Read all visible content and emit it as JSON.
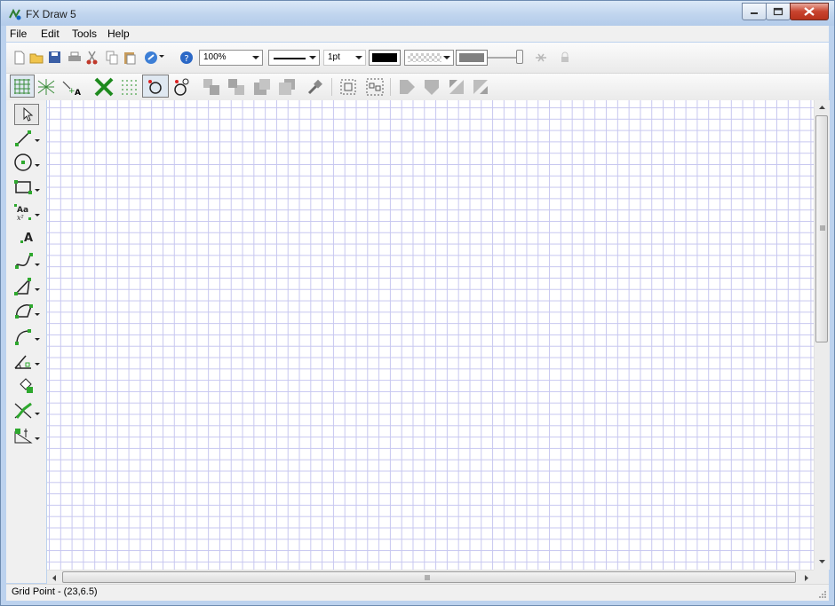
{
  "window": {
    "title": "FX Draw 5"
  },
  "menu": {
    "file": "File",
    "edit": "Edit",
    "tools": "Tools",
    "help": "Help"
  },
  "toolbar": {
    "zoom": "100%",
    "line_width": "1pt",
    "line_color": "#000000",
    "fill_color": "#808080"
  },
  "status": {
    "text": "Grid Point - (23,6.5)"
  },
  "grid": {
    "line_color": "#c7c7f0"
  }
}
